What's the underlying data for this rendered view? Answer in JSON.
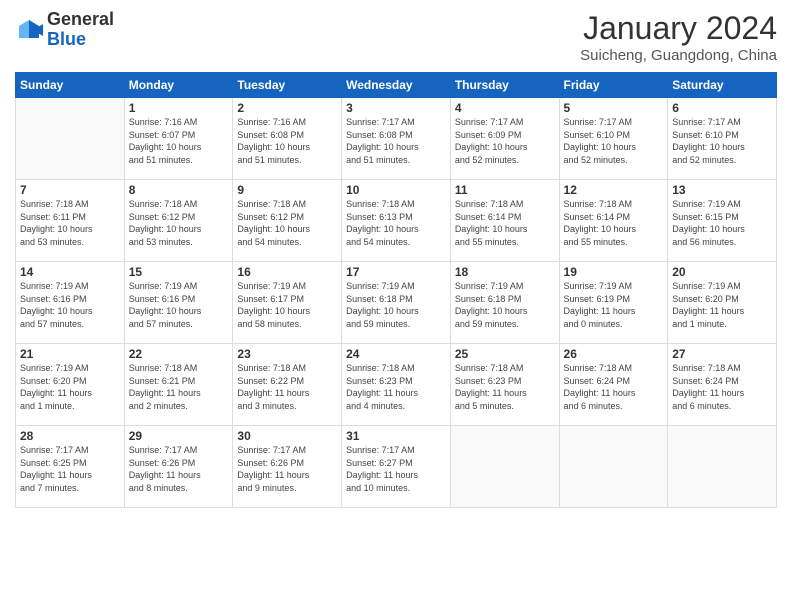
{
  "header": {
    "logo_general": "General",
    "logo_blue": "Blue",
    "month_title": "January 2024",
    "subtitle": "Suicheng, Guangdong, China"
  },
  "weekdays": [
    "Sunday",
    "Monday",
    "Tuesday",
    "Wednesday",
    "Thursday",
    "Friday",
    "Saturday"
  ],
  "weeks": [
    [
      {
        "day": "",
        "info": ""
      },
      {
        "day": "1",
        "info": "Sunrise: 7:16 AM\nSunset: 6:07 PM\nDaylight: 10 hours\nand 51 minutes."
      },
      {
        "day": "2",
        "info": "Sunrise: 7:16 AM\nSunset: 6:08 PM\nDaylight: 10 hours\nand 51 minutes."
      },
      {
        "day": "3",
        "info": "Sunrise: 7:17 AM\nSunset: 6:08 PM\nDaylight: 10 hours\nand 51 minutes."
      },
      {
        "day": "4",
        "info": "Sunrise: 7:17 AM\nSunset: 6:09 PM\nDaylight: 10 hours\nand 52 minutes."
      },
      {
        "day": "5",
        "info": "Sunrise: 7:17 AM\nSunset: 6:10 PM\nDaylight: 10 hours\nand 52 minutes."
      },
      {
        "day": "6",
        "info": "Sunrise: 7:17 AM\nSunset: 6:10 PM\nDaylight: 10 hours\nand 52 minutes."
      }
    ],
    [
      {
        "day": "7",
        "info": "Sunrise: 7:18 AM\nSunset: 6:11 PM\nDaylight: 10 hours\nand 53 minutes."
      },
      {
        "day": "8",
        "info": "Sunrise: 7:18 AM\nSunset: 6:12 PM\nDaylight: 10 hours\nand 53 minutes."
      },
      {
        "day": "9",
        "info": "Sunrise: 7:18 AM\nSunset: 6:12 PM\nDaylight: 10 hours\nand 54 minutes."
      },
      {
        "day": "10",
        "info": "Sunrise: 7:18 AM\nSunset: 6:13 PM\nDaylight: 10 hours\nand 54 minutes."
      },
      {
        "day": "11",
        "info": "Sunrise: 7:18 AM\nSunset: 6:14 PM\nDaylight: 10 hours\nand 55 minutes."
      },
      {
        "day": "12",
        "info": "Sunrise: 7:18 AM\nSunset: 6:14 PM\nDaylight: 10 hours\nand 55 minutes."
      },
      {
        "day": "13",
        "info": "Sunrise: 7:19 AM\nSunset: 6:15 PM\nDaylight: 10 hours\nand 56 minutes."
      }
    ],
    [
      {
        "day": "14",
        "info": "Sunrise: 7:19 AM\nSunset: 6:16 PM\nDaylight: 10 hours\nand 57 minutes."
      },
      {
        "day": "15",
        "info": "Sunrise: 7:19 AM\nSunset: 6:16 PM\nDaylight: 10 hours\nand 57 minutes."
      },
      {
        "day": "16",
        "info": "Sunrise: 7:19 AM\nSunset: 6:17 PM\nDaylight: 10 hours\nand 58 minutes."
      },
      {
        "day": "17",
        "info": "Sunrise: 7:19 AM\nSunset: 6:18 PM\nDaylight: 10 hours\nand 59 minutes."
      },
      {
        "day": "18",
        "info": "Sunrise: 7:19 AM\nSunset: 6:18 PM\nDaylight: 10 hours\nand 59 minutes."
      },
      {
        "day": "19",
        "info": "Sunrise: 7:19 AM\nSunset: 6:19 PM\nDaylight: 11 hours\nand 0 minutes."
      },
      {
        "day": "20",
        "info": "Sunrise: 7:19 AM\nSunset: 6:20 PM\nDaylight: 11 hours\nand 1 minute."
      }
    ],
    [
      {
        "day": "21",
        "info": "Sunrise: 7:19 AM\nSunset: 6:20 PM\nDaylight: 11 hours\nand 1 minute."
      },
      {
        "day": "22",
        "info": "Sunrise: 7:18 AM\nSunset: 6:21 PM\nDaylight: 11 hours\nand 2 minutes."
      },
      {
        "day": "23",
        "info": "Sunrise: 7:18 AM\nSunset: 6:22 PM\nDaylight: 11 hours\nand 3 minutes."
      },
      {
        "day": "24",
        "info": "Sunrise: 7:18 AM\nSunset: 6:23 PM\nDaylight: 11 hours\nand 4 minutes."
      },
      {
        "day": "25",
        "info": "Sunrise: 7:18 AM\nSunset: 6:23 PM\nDaylight: 11 hours\nand 5 minutes."
      },
      {
        "day": "26",
        "info": "Sunrise: 7:18 AM\nSunset: 6:24 PM\nDaylight: 11 hours\nand 6 minutes."
      },
      {
        "day": "27",
        "info": "Sunrise: 7:18 AM\nSunset: 6:24 PM\nDaylight: 11 hours\nand 6 minutes."
      }
    ],
    [
      {
        "day": "28",
        "info": "Sunrise: 7:17 AM\nSunset: 6:25 PM\nDaylight: 11 hours\nand 7 minutes."
      },
      {
        "day": "29",
        "info": "Sunrise: 7:17 AM\nSunset: 6:26 PM\nDaylight: 11 hours\nand 8 minutes."
      },
      {
        "day": "30",
        "info": "Sunrise: 7:17 AM\nSunset: 6:26 PM\nDaylight: 11 hours\nand 9 minutes."
      },
      {
        "day": "31",
        "info": "Sunrise: 7:17 AM\nSunset: 6:27 PM\nDaylight: 11 hours\nand 10 minutes."
      },
      {
        "day": "",
        "info": ""
      },
      {
        "day": "",
        "info": ""
      },
      {
        "day": "",
        "info": ""
      }
    ]
  ]
}
